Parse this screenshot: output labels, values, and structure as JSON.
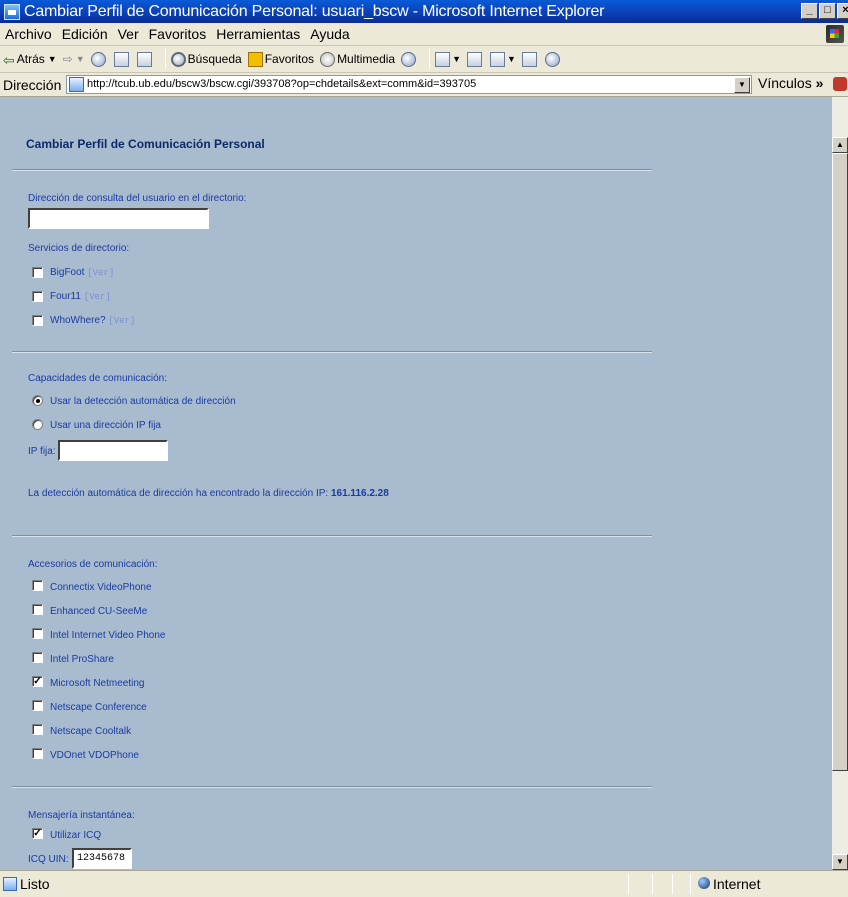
{
  "window": {
    "title": "Cambiar Perfil de Comunicación Personal: usuari_bscw - Microsoft Internet Explorer",
    "buttons": [
      "_",
      "□",
      "×"
    ]
  },
  "menubar": {
    "items": [
      "Archivo",
      "Edición",
      "Ver",
      "Favoritos",
      "Herramientas",
      "Ayuda"
    ]
  },
  "toolbar": {
    "back": "Atrás",
    "search": "Búsqueda",
    "favorites": "Favoritos",
    "media": "Multimedia"
  },
  "addressbar": {
    "label": "Dirección",
    "url": "http://tcub.ub.edu/bscw3/bscw.cgi/393708?op=chdetails&ext=comm&id=393705",
    "links": "Vínculos"
  },
  "page": {
    "title": "Cambiar Perfil de Comunicación Personal",
    "lookup_label": "Dirección de consulta del usuario en el directorio:",
    "lookup_value": "",
    "directory_label": "Servicios de directorio:",
    "view_link": "[Ver]",
    "directory_services": [
      {
        "name": "BigFoot",
        "checked": false
      },
      {
        "name": "Four11",
        "checked": false
      },
      {
        "name": "WhoWhere?",
        "checked": false
      }
    ],
    "capabilities_label": "Capacidades de comunicación:",
    "radio_auto": "Usar la detección automática de dirección",
    "radio_fixed": "Usar una dirección IP fija",
    "fixed_ip_label": "IP fija:",
    "fixed_ip_value": "",
    "detected_text": "La detección automática de dirección ha encontrado la dirección IP:",
    "detected_ip": "161.116.2.28",
    "accessories_label": "Accesorios de comunicación:",
    "accessories": [
      {
        "name": "Connectix VideoPhone",
        "checked": false
      },
      {
        "name": "Enhanced CU-SeeMe",
        "checked": false
      },
      {
        "name": "Intel Internet Video Phone",
        "checked": false
      },
      {
        "name": "Intel ProShare",
        "checked": false
      },
      {
        "name": "Microsoft Netmeeting",
        "checked": true
      },
      {
        "name": "Netscape Conference",
        "checked": false
      },
      {
        "name": "Netscape Cooltalk",
        "checked": false
      },
      {
        "name": "VDOnet VDOPhone",
        "checked": false
      }
    ],
    "im_label": "Mensajería instantánea:",
    "use_icq": "Utilizar ICQ",
    "icq_label": "ICQ UIN:",
    "icq_value": "12345678"
  },
  "statusbar": {
    "text": "Listo",
    "zone": "Internet"
  },
  "colors": {
    "page_background": "#a9bccf",
    "label_text": "#1a3aa0",
    "title_text": "#0b2a66",
    "titlebar": "#0b3fb4"
  }
}
